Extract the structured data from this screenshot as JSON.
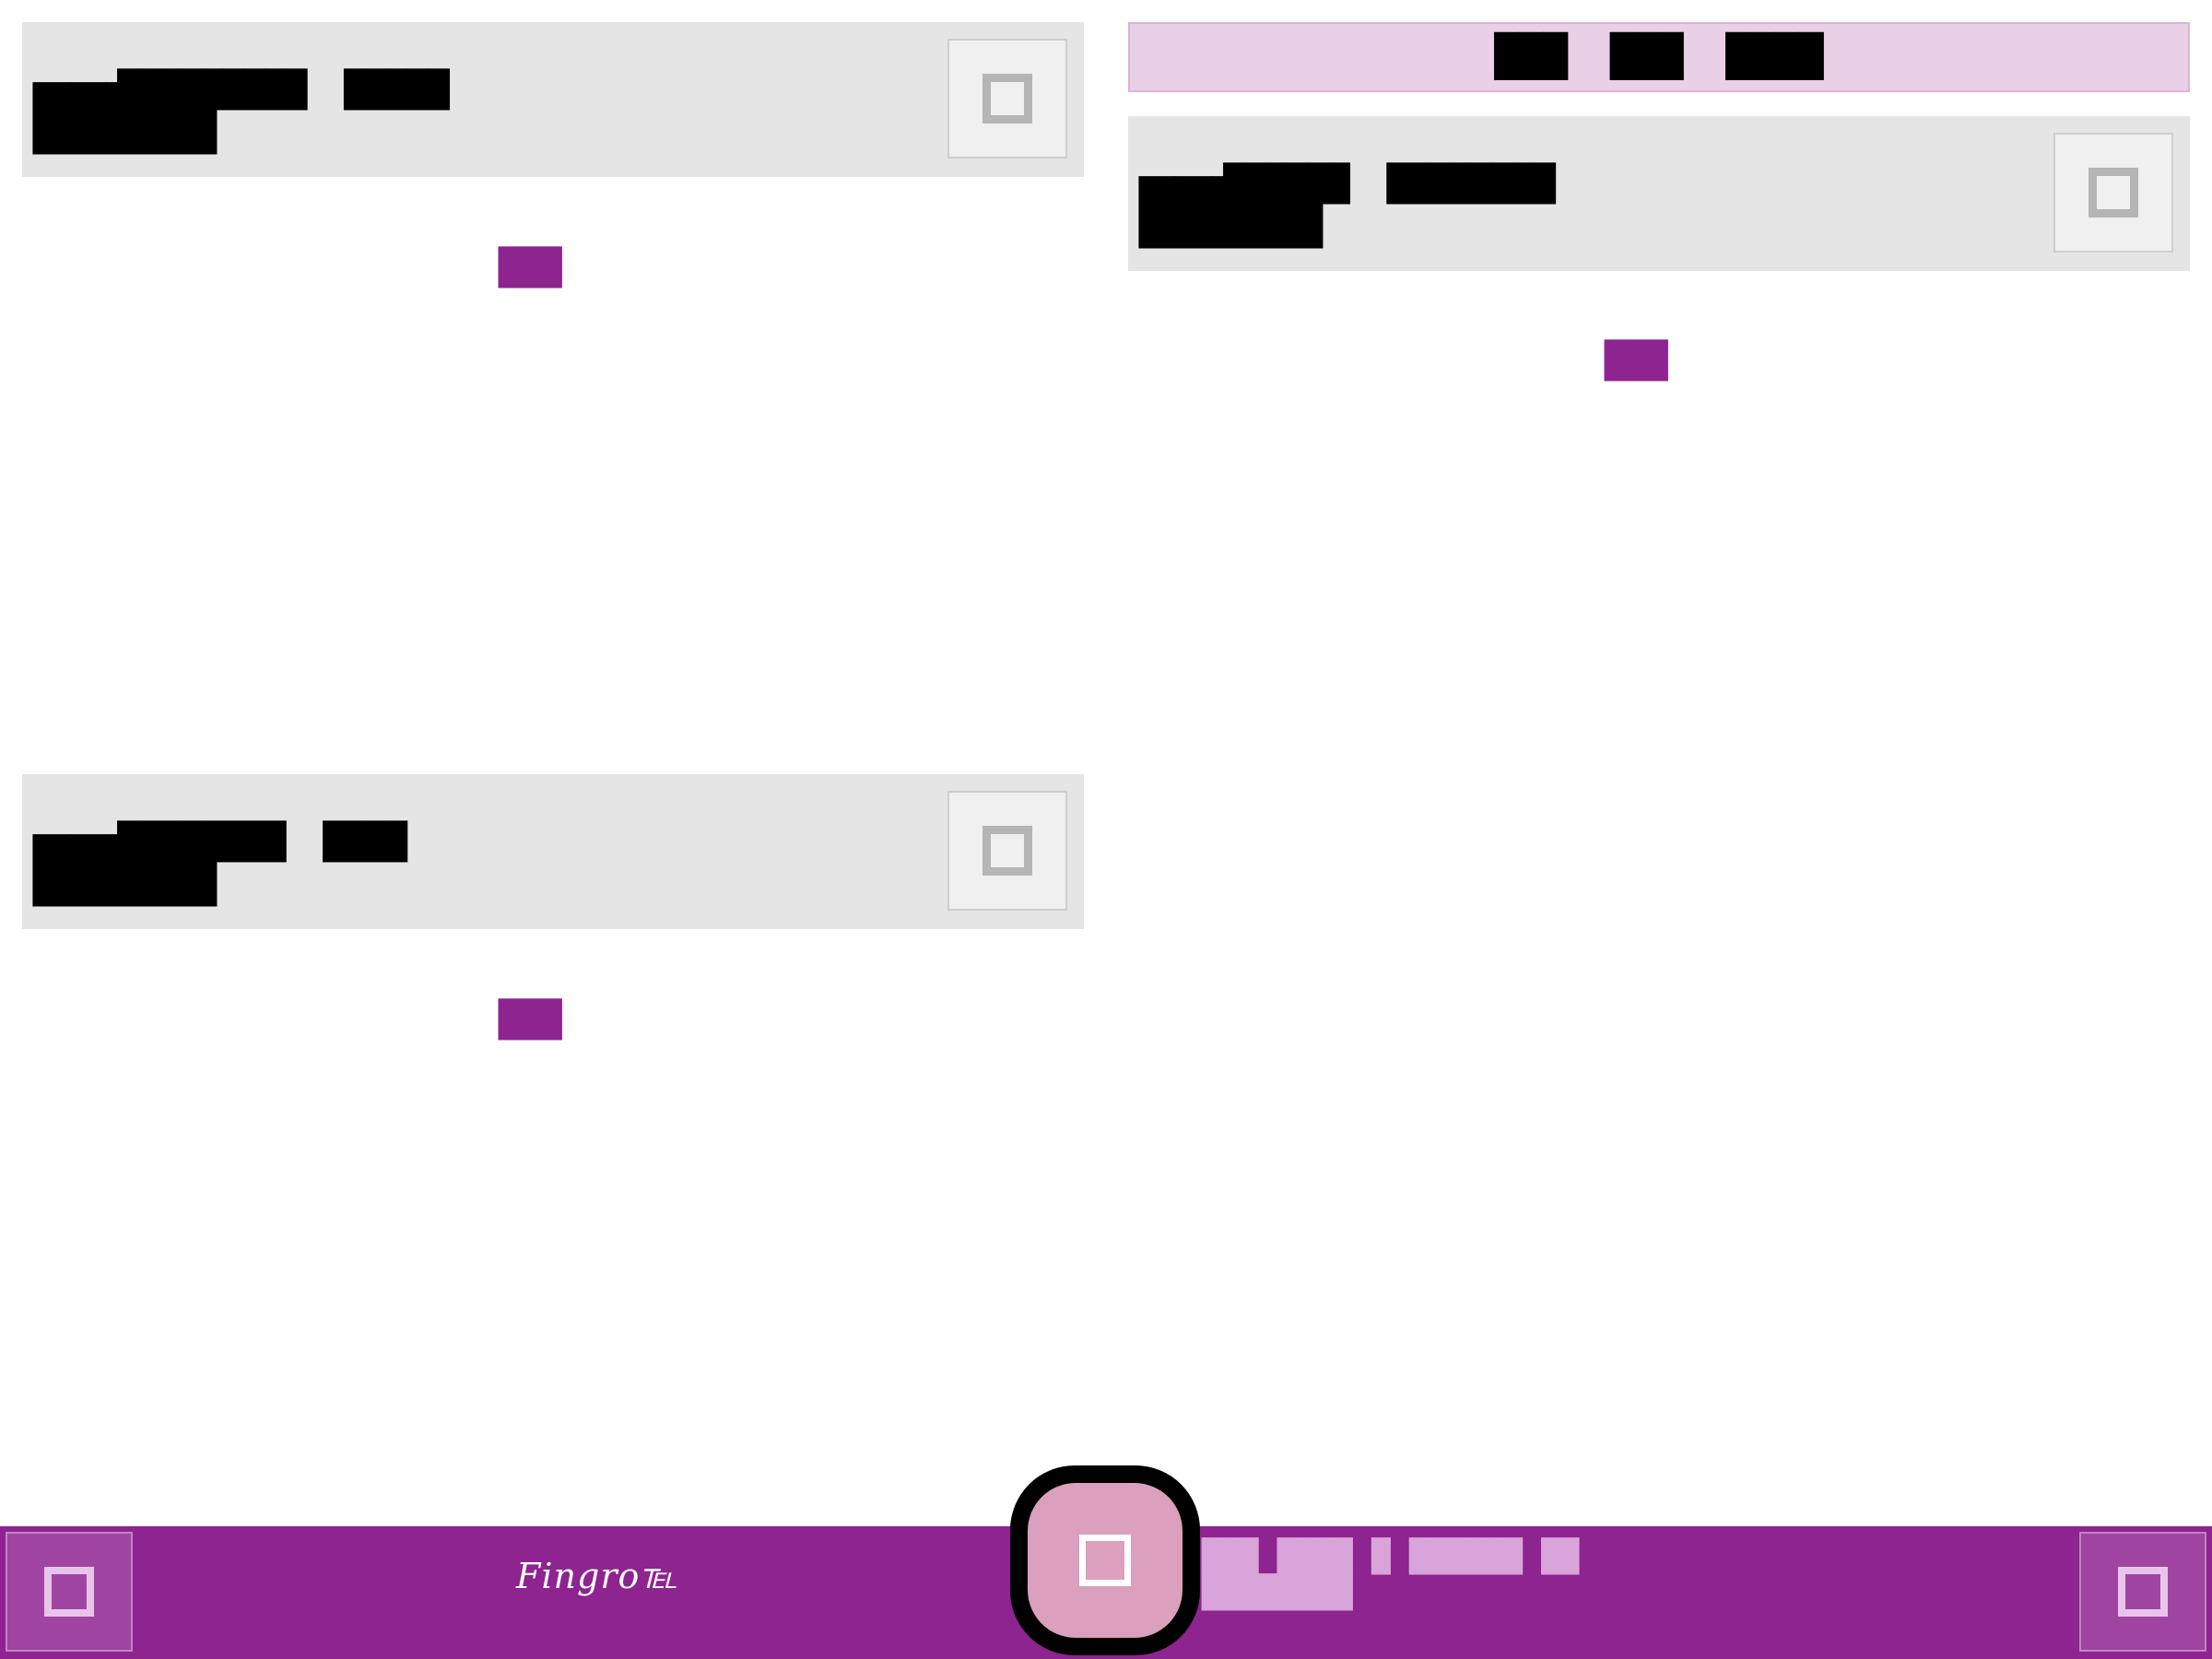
{
  "filter_bar": {
    "items": [
      "███",
      "███",
      "████"
    ]
  },
  "panels": [
    {
      "title_a": "█████████",
      "title_b": "█████",
      "big": "█████",
      "more": "███"
    },
    {
      "title_a": "██████",
      "title_b": "████████",
      "big": "█████",
      "more": "███"
    },
    {
      "title_a": "████████",
      "title_b": "████",
      "big": "█████",
      "more": "███"
    }
  ],
  "bottom_bar": {
    "brand": "Fingro℡",
    "text_line1": "███ ████ █ ██████ ██",
    "text_line2": "████████",
    "left_icon": "square-icon",
    "right_icon": "square-icon",
    "center_icon": "square-icon"
  },
  "colors": {
    "accent": "#8d2490",
    "accent_light": "#e9d0e6",
    "panel_bg": "#e5e5e5",
    "center_btn": "#dba0bd"
  }
}
